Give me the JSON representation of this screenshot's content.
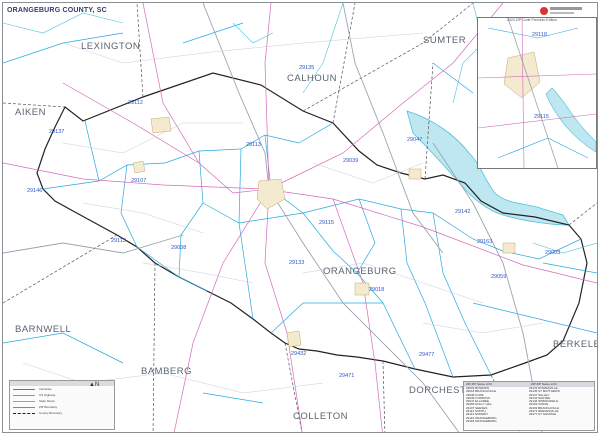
{
  "map": {
    "title": "ORANGEBURG COUNTY, SC",
    "edition": "2020 ZIP Code Premium Edition",
    "colors": {
      "county_boundary": "#222222",
      "zip_boundary": "#29a8e0",
      "highway": "#9aa3ad",
      "primary_route": "#d46bb9",
      "water": "#4fc2d9",
      "zip_label": "#2f55c9",
      "county_label": "#5a6470"
    }
  },
  "counties": [
    {
      "name": "LEXINGTON"
    },
    {
      "name": "CALHOUN"
    },
    {
      "name": "SUMTER"
    },
    {
      "name": "AIKEN"
    },
    {
      "name": "ORANGEBURG"
    },
    {
      "name": "BARNWELL"
    },
    {
      "name": "BAMBERG"
    },
    {
      "name": "COLLETON"
    },
    {
      "name": "DORCHESTER"
    },
    {
      "name": "BERKELEY"
    }
  ],
  "zips": [
    {
      "code": "29135"
    },
    {
      "code": "29112"
    },
    {
      "code": "29137"
    },
    {
      "code": "29047"
    },
    {
      "code": "29113"
    },
    {
      "code": "29039"
    },
    {
      "code": "29107"
    },
    {
      "code": "29146"
    },
    {
      "code": "29115"
    },
    {
      "code": "29142"
    },
    {
      "code": "29038"
    },
    {
      "code": "29133"
    },
    {
      "code": "29163"
    },
    {
      "code": "29003"
    },
    {
      "code": "29059"
    },
    {
      "code": "29018"
    },
    {
      "code": "29432"
    },
    {
      "code": "29477"
    },
    {
      "code": "29471"
    },
    {
      "code": "29113"
    }
  ],
  "inset_zips": [
    {
      "code": "29118"
    },
    {
      "code": "29115"
    }
  ],
  "legend": {
    "items": [
      {
        "label": "Interstate",
        "color": "#6b7580"
      },
      {
        "label": "US Highway",
        "color": "#d46bb9"
      },
      {
        "label": "State Route",
        "color": "#9aa3ad"
      },
      {
        "label": "ZIP Boundary",
        "color": "#29a8e0"
      },
      {
        "label": "County Boundary",
        "color": "#222222"
      }
    ],
    "north": "N"
  },
  "zip_table": {
    "header_left": "ZIP  ZIP Name  LOC",
    "header_right": "ZIP  ZIP Name  LOC",
    "left_entries": [
      "29003  BOWMAN",
      "29018  BRANCHVILLE",
      "29038  COPE",
      "29039  CORDOVA",
      "29047  ELLOREE",
      "29059  HOLLY HILL",
      "29107  NEESES",
      "29112  NORTH",
      "29113  NORWAY",
      "29115  ORANGEBURG",
      "29118  ORANGEBURG"
    ],
    "right_entries": [
      "29133  ROWESVILLE",
      "29135  ST MATTHEWS",
      "29137  SALLEY",
      "29142  SANTEE",
      "29146  SPRINGFIELD",
      "29163  VANCE",
      "29432  BRANCHVILLE",
      "29471  REEVESVILLE",
      "29477  ST GEORGE"
    ]
  }
}
